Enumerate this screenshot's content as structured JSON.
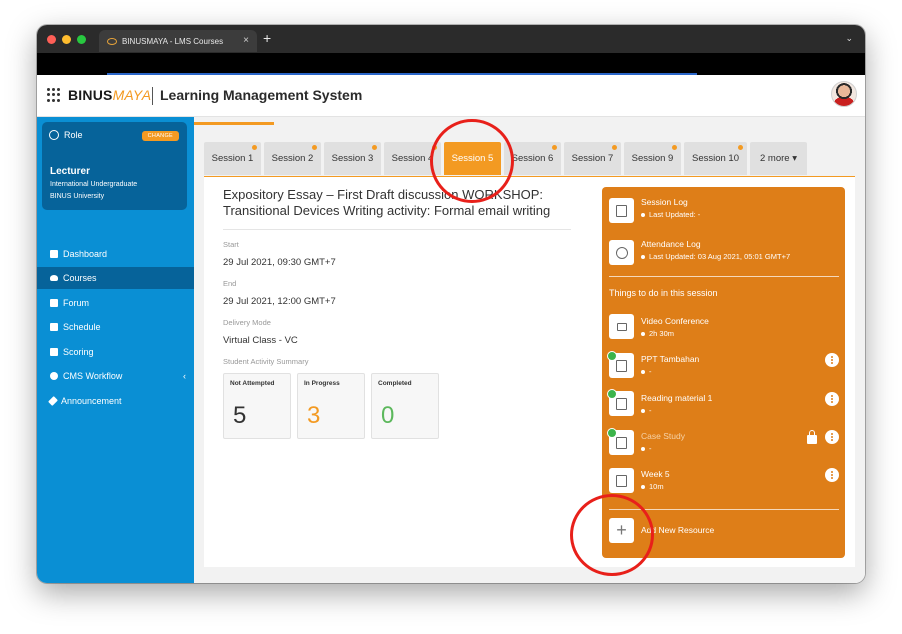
{
  "browser": {
    "tab_title": "BINUSMAYA - LMS Courses",
    "tab_close": "×",
    "new_tab": "+",
    "window_chevron": "⌄"
  },
  "header": {
    "logo_binus": "BINUS",
    "logo_maya": "MAYA",
    "app_title": "Learning Management System"
  },
  "role": {
    "label": "Role",
    "change_label": "CHANGE",
    "name": "Lecturer",
    "program": "International Undergraduate",
    "institution": "BINUS University"
  },
  "sidebar": {
    "items": [
      {
        "label": "Dashboard",
        "icon": "dashboard-icon"
      },
      {
        "label": "Courses",
        "icon": "graduation-cap-icon"
      },
      {
        "label": "Forum",
        "icon": "chat-icon"
      },
      {
        "label": "Schedule",
        "icon": "calendar-icon"
      },
      {
        "label": "Scoring",
        "icon": "checkbox-icon"
      },
      {
        "label": "CMS Workflow",
        "icon": "workflow-icon",
        "chevron": "‹"
      },
      {
        "label": "Announcement",
        "icon": "megaphone-icon"
      }
    ]
  },
  "tabs": [
    {
      "label": "Session 1"
    },
    {
      "label": "Session 2"
    },
    {
      "label": "Session 3"
    },
    {
      "label": "Session 4"
    },
    {
      "label": "Session 5"
    },
    {
      "label": "Session 6"
    },
    {
      "label": "Session 7"
    },
    {
      "label": "Session 9"
    },
    {
      "label": "Session 10"
    },
    {
      "label": "2 more ▾"
    }
  ],
  "session": {
    "title": "Expository Essay – First Draft discussion WORKSHOP: Transitional Devices Writing activity: Formal email writing",
    "start_label": "Start",
    "start_value": "29 Jul 2021, 09:30 GMT+7",
    "end_label": "End",
    "end_value": "29 Jul 2021, 12:00 GMT+7",
    "delivery_label": "Delivery Mode",
    "delivery_value": "Virtual Class - VC",
    "summary_label": "Student Activity Summary",
    "stats": [
      {
        "label": "Not Attempted",
        "value": "5",
        "color": "#333333"
      },
      {
        "label": "In Progress",
        "value": "3",
        "color": "#f39a22"
      },
      {
        "label": "Completed",
        "value": "0",
        "color": "#5cb85c"
      }
    ]
  },
  "panel": {
    "session_log_title": "Session Log",
    "session_log_sub": "Last Updated: -",
    "attendance_title": "Attendance Log",
    "attendance_sub": "Last Updated: 03 Aug 2021, 05:01 GMT+7",
    "section_title": "Things to do in this session",
    "items": [
      {
        "title": "Video Conference",
        "sub": "2h 30m"
      },
      {
        "title": "PPT Tambahan",
        "sub": "-"
      },
      {
        "title": "Reading material 1",
        "sub": "-"
      },
      {
        "title": "Case Study",
        "sub": "-"
      },
      {
        "title": "Week 5",
        "sub": "10m"
      }
    ],
    "add_label": "Add New Resource",
    "add_symbol": "+"
  },
  "colors": {
    "accent_orange": "#f39a22",
    "sidebar_blue": "#0a8fd4",
    "panel_orange": "#de7e18",
    "annotation_red": "#e8201a"
  }
}
